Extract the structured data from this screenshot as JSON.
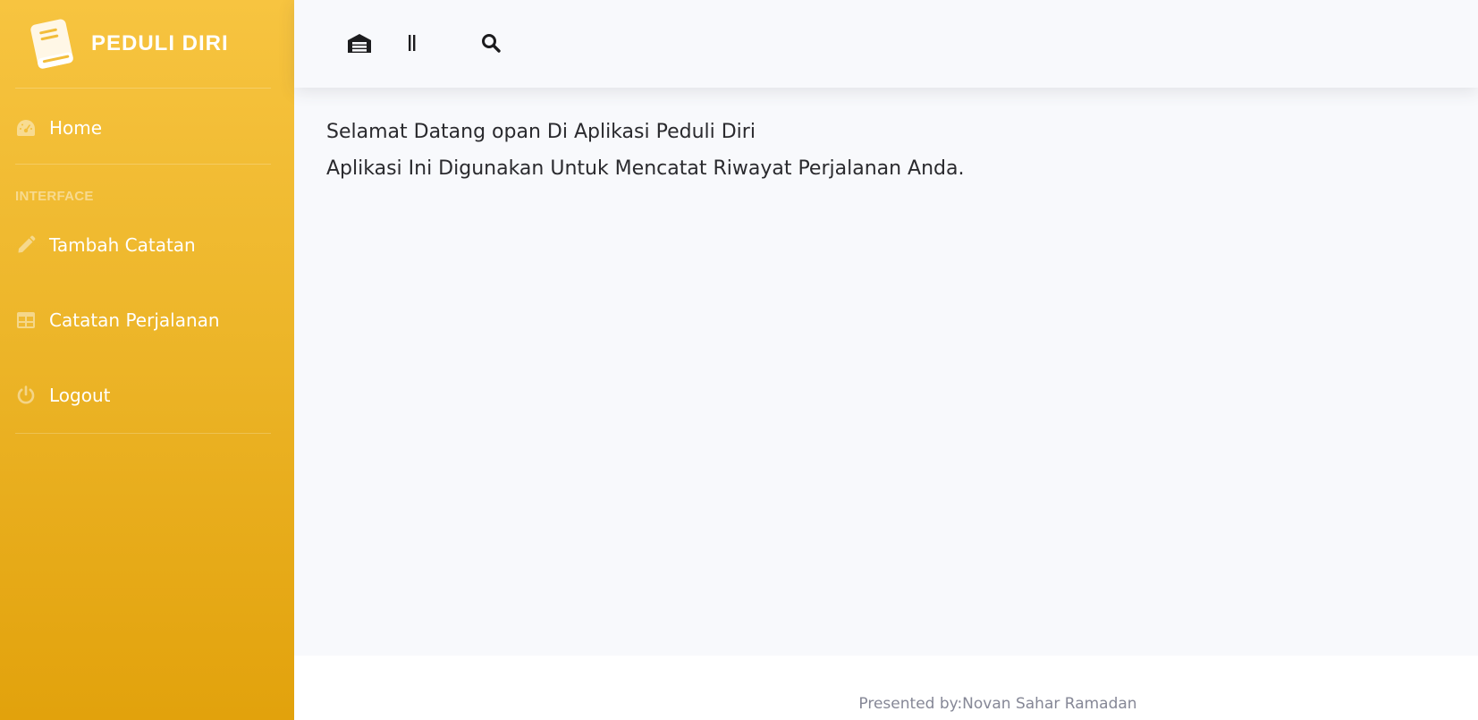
{
  "sidebar": {
    "brand": {
      "title": "PEDULI DIRI",
      "icon": "book-icon"
    },
    "items": [
      {
        "label": "Home",
        "icon": "tachometer-icon"
      },
      {
        "label": "Tambah Catatan",
        "icon": "pencil-icon"
      },
      {
        "label": "Catatan Perjalanan",
        "icon": "table-icon"
      },
      {
        "label": "Logout",
        "icon": "power-icon"
      }
    ],
    "heading": "INTERFACE"
  },
  "topbar": {
    "buttons": [
      {
        "icon": "warehouse-icon"
      },
      {
        "icon": "pause-bars-icon"
      },
      {
        "icon": "search-icon"
      }
    ]
  },
  "main": {
    "line1": "Selamat Datang opan Di Aplikasi Peduli Diri",
    "line2": "Aplikasi Ini Digunakan Untuk Mencatat Riwayat Perjalanan Anda."
  },
  "footer": {
    "text": "Presented by:Novan Sahar Ramadan"
  },
  "colors": {
    "sidebar_top": "#f7c440",
    "sidebar_bottom": "#e2a20c",
    "page_background": "#f8f9fc",
    "text_dark": "#2a2a2e",
    "footer_text": "#858796"
  }
}
